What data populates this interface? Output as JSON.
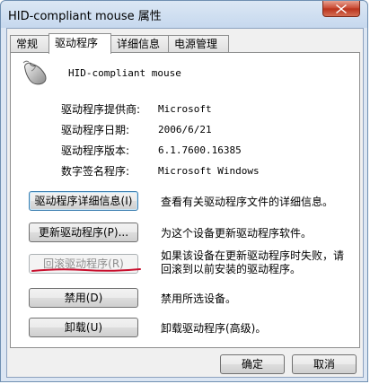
{
  "window": {
    "title": "HID-compliant mouse 属性",
    "close_icon": "close-x"
  },
  "tabs": [
    "常规",
    "驱动程序",
    "详细信息",
    "电源管理"
  ],
  "active_tab": 1,
  "device": {
    "name": "HID-compliant mouse",
    "icon": "mouse-icon"
  },
  "info": [
    {
      "label": "驱动程序提供商:",
      "value": "Microsoft"
    },
    {
      "label": "驱动程序日期:",
      "value": "2006/6/21"
    },
    {
      "label": "驱动程序版本:",
      "value": "6.1.7600.16385"
    },
    {
      "label": "数字签名程序:",
      "value": "Microsoft Windows"
    }
  ],
  "actions": [
    {
      "button": "驱动程序详细信息(I)",
      "desc": "查看有关驱动程序文件的详细信息。"
    },
    {
      "button": "更新驱动程序(P)...",
      "desc": "为这个设备更新驱动程序软件。"
    },
    {
      "button": "回滚驱动程序(R)",
      "desc": "如果该设备在更新驱动程序时失败，请回滚到以前安装的驱动程序。",
      "disabled": true
    },
    {
      "button": "禁用(D)",
      "desc": "禁用所选设备。"
    },
    {
      "button": "卸载(U)",
      "desc": "卸载驱动程序(高级)。"
    }
  ],
  "footer": {
    "ok": "确定",
    "cancel": "取消"
  },
  "colors": {
    "accent_underline": "#c8102e",
    "title_gradient_top": "#dbe7f4"
  }
}
